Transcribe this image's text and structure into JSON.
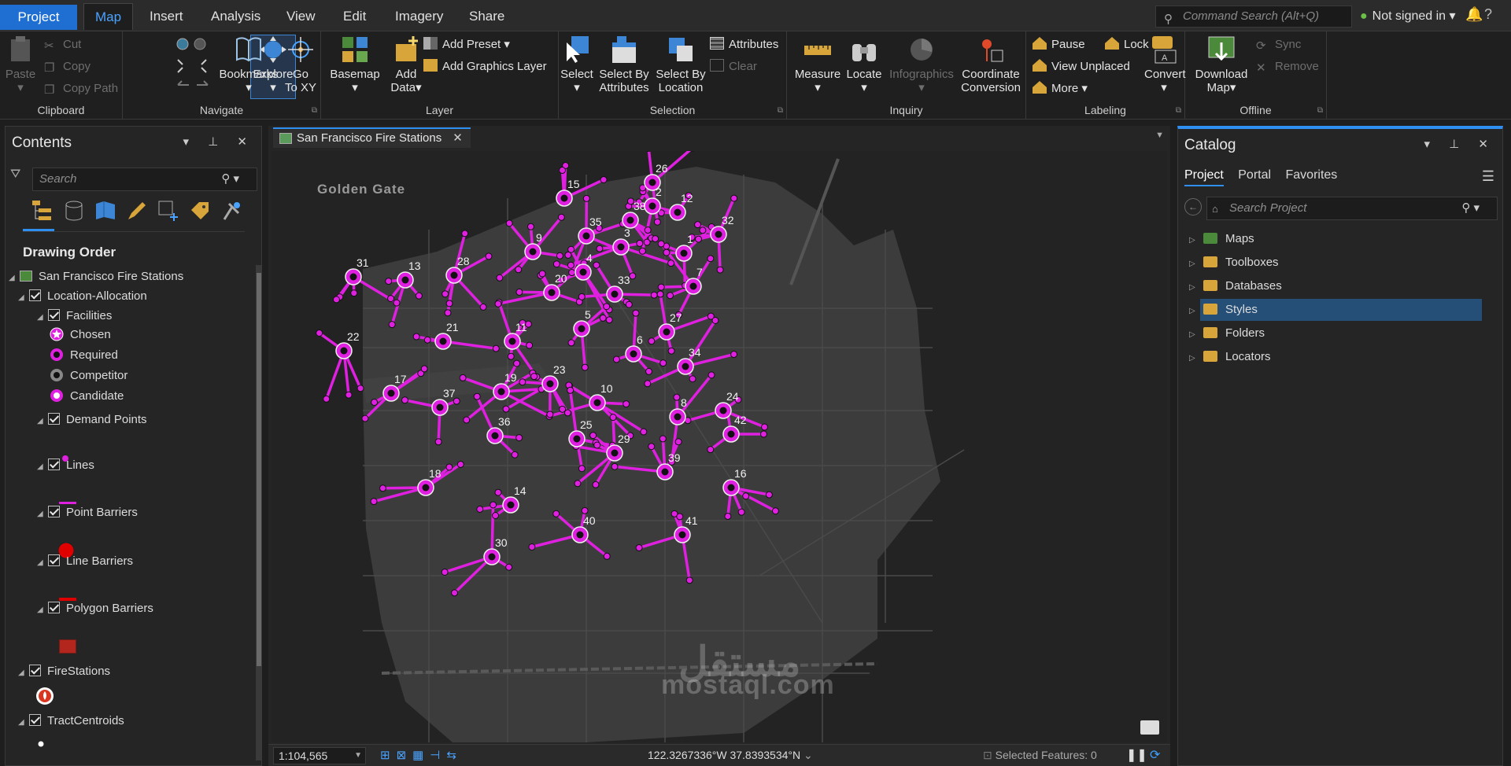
{
  "tabs": {
    "project": "Project",
    "items": [
      "Map",
      "Insert",
      "Analysis",
      "View",
      "Edit",
      "Imagery",
      "Share"
    ],
    "active": "Map"
  },
  "command_search": {
    "placeholder": "Command Search (Alt+Q)"
  },
  "account": {
    "status": "Not signed in"
  },
  "ribbon": {
    "clipboard": {
      "label": "Clipboard",
      "paste": "Paste",
      "cut": "Cut",
      "copy": "Copy",
      "copy_path": "Copy Path"
    },
    "navigate": {
      "label": "Navigate",
      "explore": "Explore",
      "bookmarks": "Bookmarks",
      "goto1": "Go",
      "goto2": "To XY"
    },
    "layer": {
      "label": "Layer",
      "basemap": "Basemap",
      "add1": "Add",
      "add2": "Data",
      "add_preset": "Add Preset",
      "add_graphics": "Add Graphics Layer"
    },
    "selection": {
      "label": "Selection",
      "select": "Select",
      "by_attr1": "Select By",
      "by_attr2": "Attributes",
      "by_loc1": "Select By",
      "by_loc2": "Location",
      "attributes": "Attributes",
      "clear": "Clear"
    },
    "inquiry": {
      "label": "Inquiry",
      "measure": "Measure",
      "locate": "Locate",
      "infographics": "Infographics",
      "coord1": "Coordinate",
      "coord2": "Conversion"
    },
    "labeling": {
      "label": "Labeling",
      "pause": "Pause",
      "lock": "Lock",
      "view_unplaced": "View Unplaced",
      "more": "More",
      "convert": "Convert"
    },
    "offline": {
      "label": "Offline",
      "download1": "Download",
      "download2": "Map",
      "sync": "Sync",
      "remove": "Remove"
    }
  },
  "contents": {
    "title": "Contents",
    "search_placeholder": "Search",
    "drawing_order": "Drawing Order",
    "map_name": "San Francisco Fire Stations",
    "layers": {
      "location_allocation": "Location-Allocation",
      "facilities": "Facilities",
      "facility_classes": [
        "Chosen",
        "Required",
        "Competitor",
        "Candidate"
      ],
      "demand_points": "Demand Points",
      "lines": "Lines",
      "point_barriers": "Point Barriers",
      "line_barriers": "Line Barriers",
      "polygon_barriers": "Polygon Barriers",
      "fire_stations": "FireStations",
      "tract_centroids": "TractCentroids"
    }
  },
  "map": {
    "tab_title": "San Francisco Fire Stations",
    "place_label": "Golden Gate",
    "facility_color": "#e020e0",
    "stations": [
      {
        "id": "1"
      },
      {
        "id": "2"
      },
      {
        "id": "3"
      },
      {
        "id": "4"
      },
      {
        "id": "5"
      },
      {
        "id": "6"
      },
      {
        "id": "7"
      },
      {
        "id": "8"
      },
      {
        "id": "9"
      },
      {
        "id": "10"
      },
      {
        "id": "11"
      },
      {
        "id": "12"
      },
      {
        "id": "13"
      },
      {
        "id": "14"
      },
      {
        "id": "15"
      },
      {
        "id": "16"
      },
      {
        "id": "17"
      },
      {
        "id": "18"
      },
      {
        "id": "19"
      },
      {
        "id": "20"
      },
      {
        "id": "21"
      },
      {
        "id": "22"
      },
      {
        "id": "23"
      },
      {
        "id": "24"
      },
      {
        "id": "25"
      },
      {
        "id": "26"
      },
      {
        "id": "27"
      },
      {
        "id": "28"
      },
      {
        "id": "29"
      },
      {
        "id": "30"
      },
      {
        "id": "31"
      },
      {
        "id": "32"
      },
      {
        "id": "33"
      },
      {
        "id": "34"
      },
      {
        "id": "35"
      },
      {
        "id": "36"
      },
      {
        "id": "37"
      },
      {
        "id": "38"
      },
      {
        "id": "39"
      },
      {
        "id": "40"
      },
      {
        "id": "41"
      },
      {
        "id": "42"
      }
    ]
  },
  "status": {
    "scale": "1:104,565",
    "coordinates": "122.3267336°W 37.8393534°N",
    "selected": "Selected Features: 0"
  },
  "catalog": {
    "title": "Catalog",
    "tabs": [
      "Project",
      "Portal",
      "Favorites"
    ],
    "search_placeholder": "Search Project",
    "items": [
      "Maps",
      "Toolboxes",
      "Databases",
      "Styles",
      "Folders",
      "Locators"
    ],
    "selected": "Styles"
  },
  "watermark": {
    "text": "mostaql.com",
    "arabic": "مستقل"
  }
}
